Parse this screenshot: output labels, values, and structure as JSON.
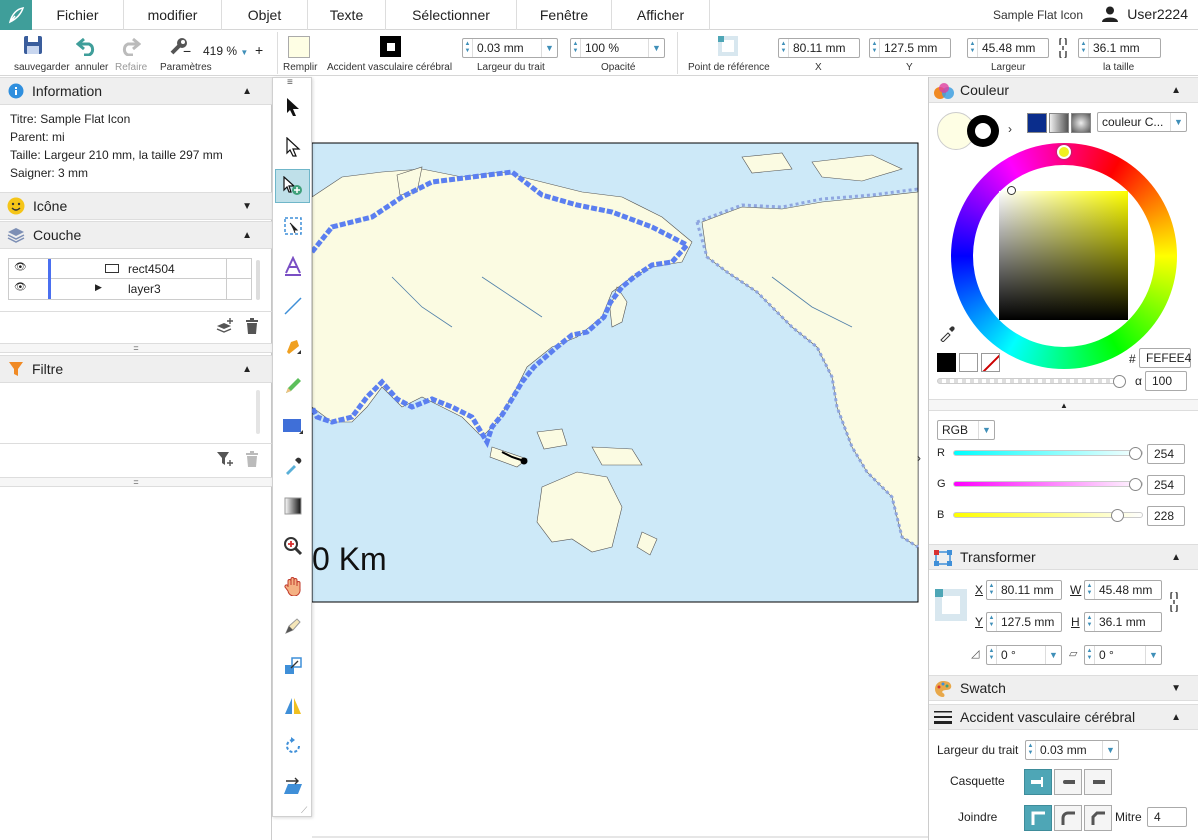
{
  "menubar": {
    "items": [
      "Fichier",
      "modifier",
      "Objet",
      "Texte",
      "Sélectionner",
      "Fenêtre",
      "Afficher"
    ],
    "doc_title": "Sample Flat Icon",
    "user": "User2224"
  },
  "toolbar": {
    "save_label": "sauvegarder",
    "undo_label": "annuler",
    "redo_label": "Refaire",
    "settings_label": "Paramètres",
    "zoom": "419 %",
    "fill_label": "Remplir",
    "stroke_label": "Accident vasculaire cérébral",
    "stroke_width_label": "Largeur du trait",
    "stroke_width": "0.03 mm",
    "opacity_label": "Opacité",
    "opacity": "100 %",
    "ref_point_label": "Point de référence",
    "x_label": "X",
    "x": "80.11 mm",
    "y_label": "Y",
    "y": "127.5 mm",
    "width_label": "Largeur",
    "width": "45.48 mm",
    "height_label": "la taille",
    "height": "36.1 mm"
  },
  "info": {
    "title": "Information",
    "line_title": "Titre:  Sample Flat Icon",
    "line_parent": "Parent:  mi",
    "line_size": "Taille:  Largeur 210 mm,  la taille 297 mm",
    "line_bleed": "Saigner:  3 mm"
  },
  "icon_panel": {
    "title": "Icône"
  },
  "layers": {
    "title": "Couche",
    "rows": [
      {
        "name": "rect4504"
      },
      {
        "name": "layer3"
      }
    ]
  },
  "filter": {
    "title": "Filtre"
  },
  "canvas": {
    "scale_text": "0 Km"
  },
  "color": {
    "title": "Couleur",
    "mode": "couleur C...",
    "hex_label": "#",
    "hex": "FEFEE4",
    "alpha_label": "α",
    "alpha": "100",
    "fill_hex": "#fefee4"
  },
  "rgb": {
    "mode": "RGB",
    "r_label": "R",
    "r": "254",
    "g_label": "G",
    "g": "254",
    "b_label": "B",
    "b": "228",
    "r_level": 0.996,
    "g_level": 0.996,
    "b_level": 0.894
  },
  "transform": {
    "title": "Transformer",
    "x_label": "X",
    "x": "80.11 mm",
    "w_label": "W",
    "w": "45.48 mm",
    "y_label": "Y",
    "y": "127.5 mm",
    "h_label": "H",
    "h": "36.1 mm",
    "rotate": "0 °",
    "skew": "0 °"
  },
  "swatch": {
    "title": "Swatch"
  },
  "stroke": {
    "title": "Accident vasculaire cérébral",
    "width_label": "Largeur du trait",
    "width": "0.03 mm",
    "cap_label": "Casquette",
    "join_label": "Joindre",
    "miter_label": "Mitre",
    "miter": "4"
  },
  "colors": {
    "accent": "#3f9e9a",
    "ocean": "#cde9f8",
    "land": "#fbfbe2",
    "selection": "#5b7ff0"
  }
}
